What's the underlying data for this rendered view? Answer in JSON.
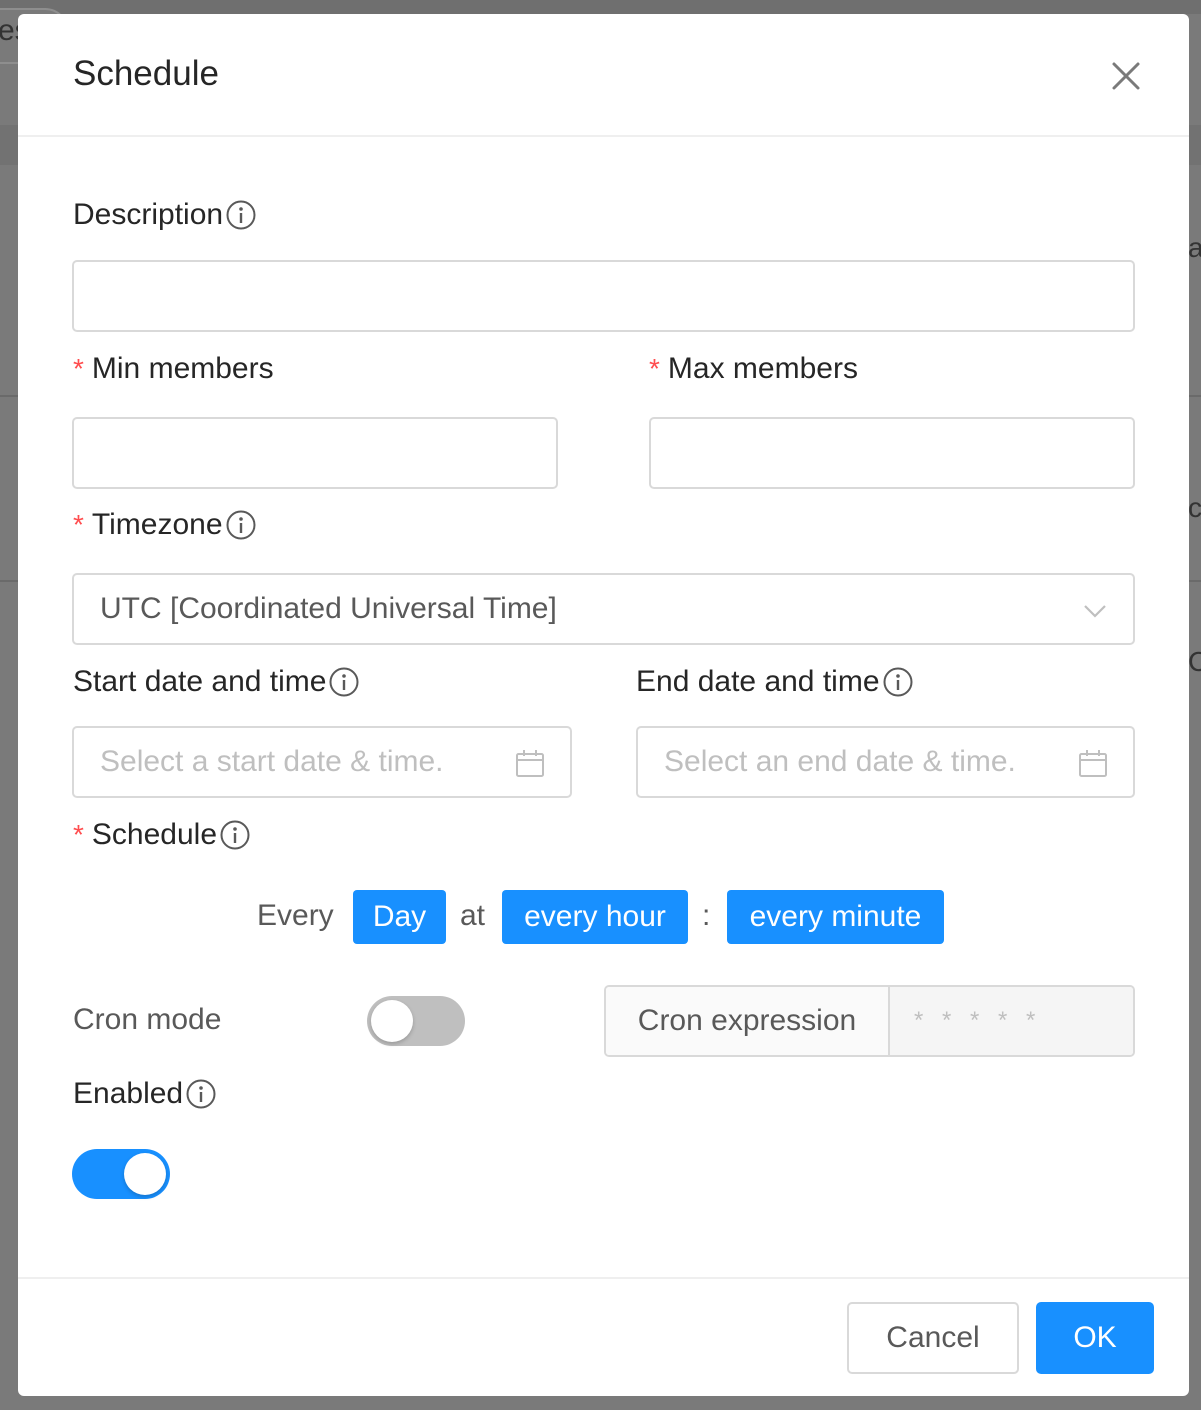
{
  "background": {
    "chip_text": "es",
    "right_chars": [
      "a",
      "c",
      "C"
    ]
  },
  "dialog": {
    "title": "Schedule",
    "close_icon": "close-icon"
  },
  "form": {
    "description": {
      "label": "Description",
      "value": "",
      "placeholder": ""
    },
    "min_members": {
      "label": "Min members",
      "required_mark": "*",
      "value": ""
    },
    "max_members": {
      "label": "Max members",
      "required_mark": "*",
      "value": ""
    },
    "timezone": {
      "label": "Timezone",
      "required_mark": "*",
      "value": "UTC [Coordinated Universal Time]"
    },
    "start_datetime": {
      "label": "Start date and time",
      "placeholder": "Select a start date & time."
    },
    "end_datetime": {
      "label": "End date and time",
      "placeholder": "Select an end date & time."
    },
    "schedule": {
      "label": "Schedule",
      "required_mark": "*",
      "every_text": "Every",
      "period": "Day",
      "at_text": "at",
      "hour": "every hour",
      "separator": ":",
      "minute": "every minute"
    },
    "cron_mode": {
      "label": "Cron mode",
      "enabled": false
    },
    "cron_expression": {
      "addon": "Cron expression",
      "placeholder": "* * * * *",
      "value": ""
    },
    "enabled": {
      "label": "Enabled",
      "value": true
    }
  },
  "footer": {
    "cancel_label": "Cancel",
    "ok_label": "OK"
  },
  "colors": {
    "primary": "#1890ff",
    "required": "#ff4d4f",
    "border": "#d9d9d9"
  }
}
